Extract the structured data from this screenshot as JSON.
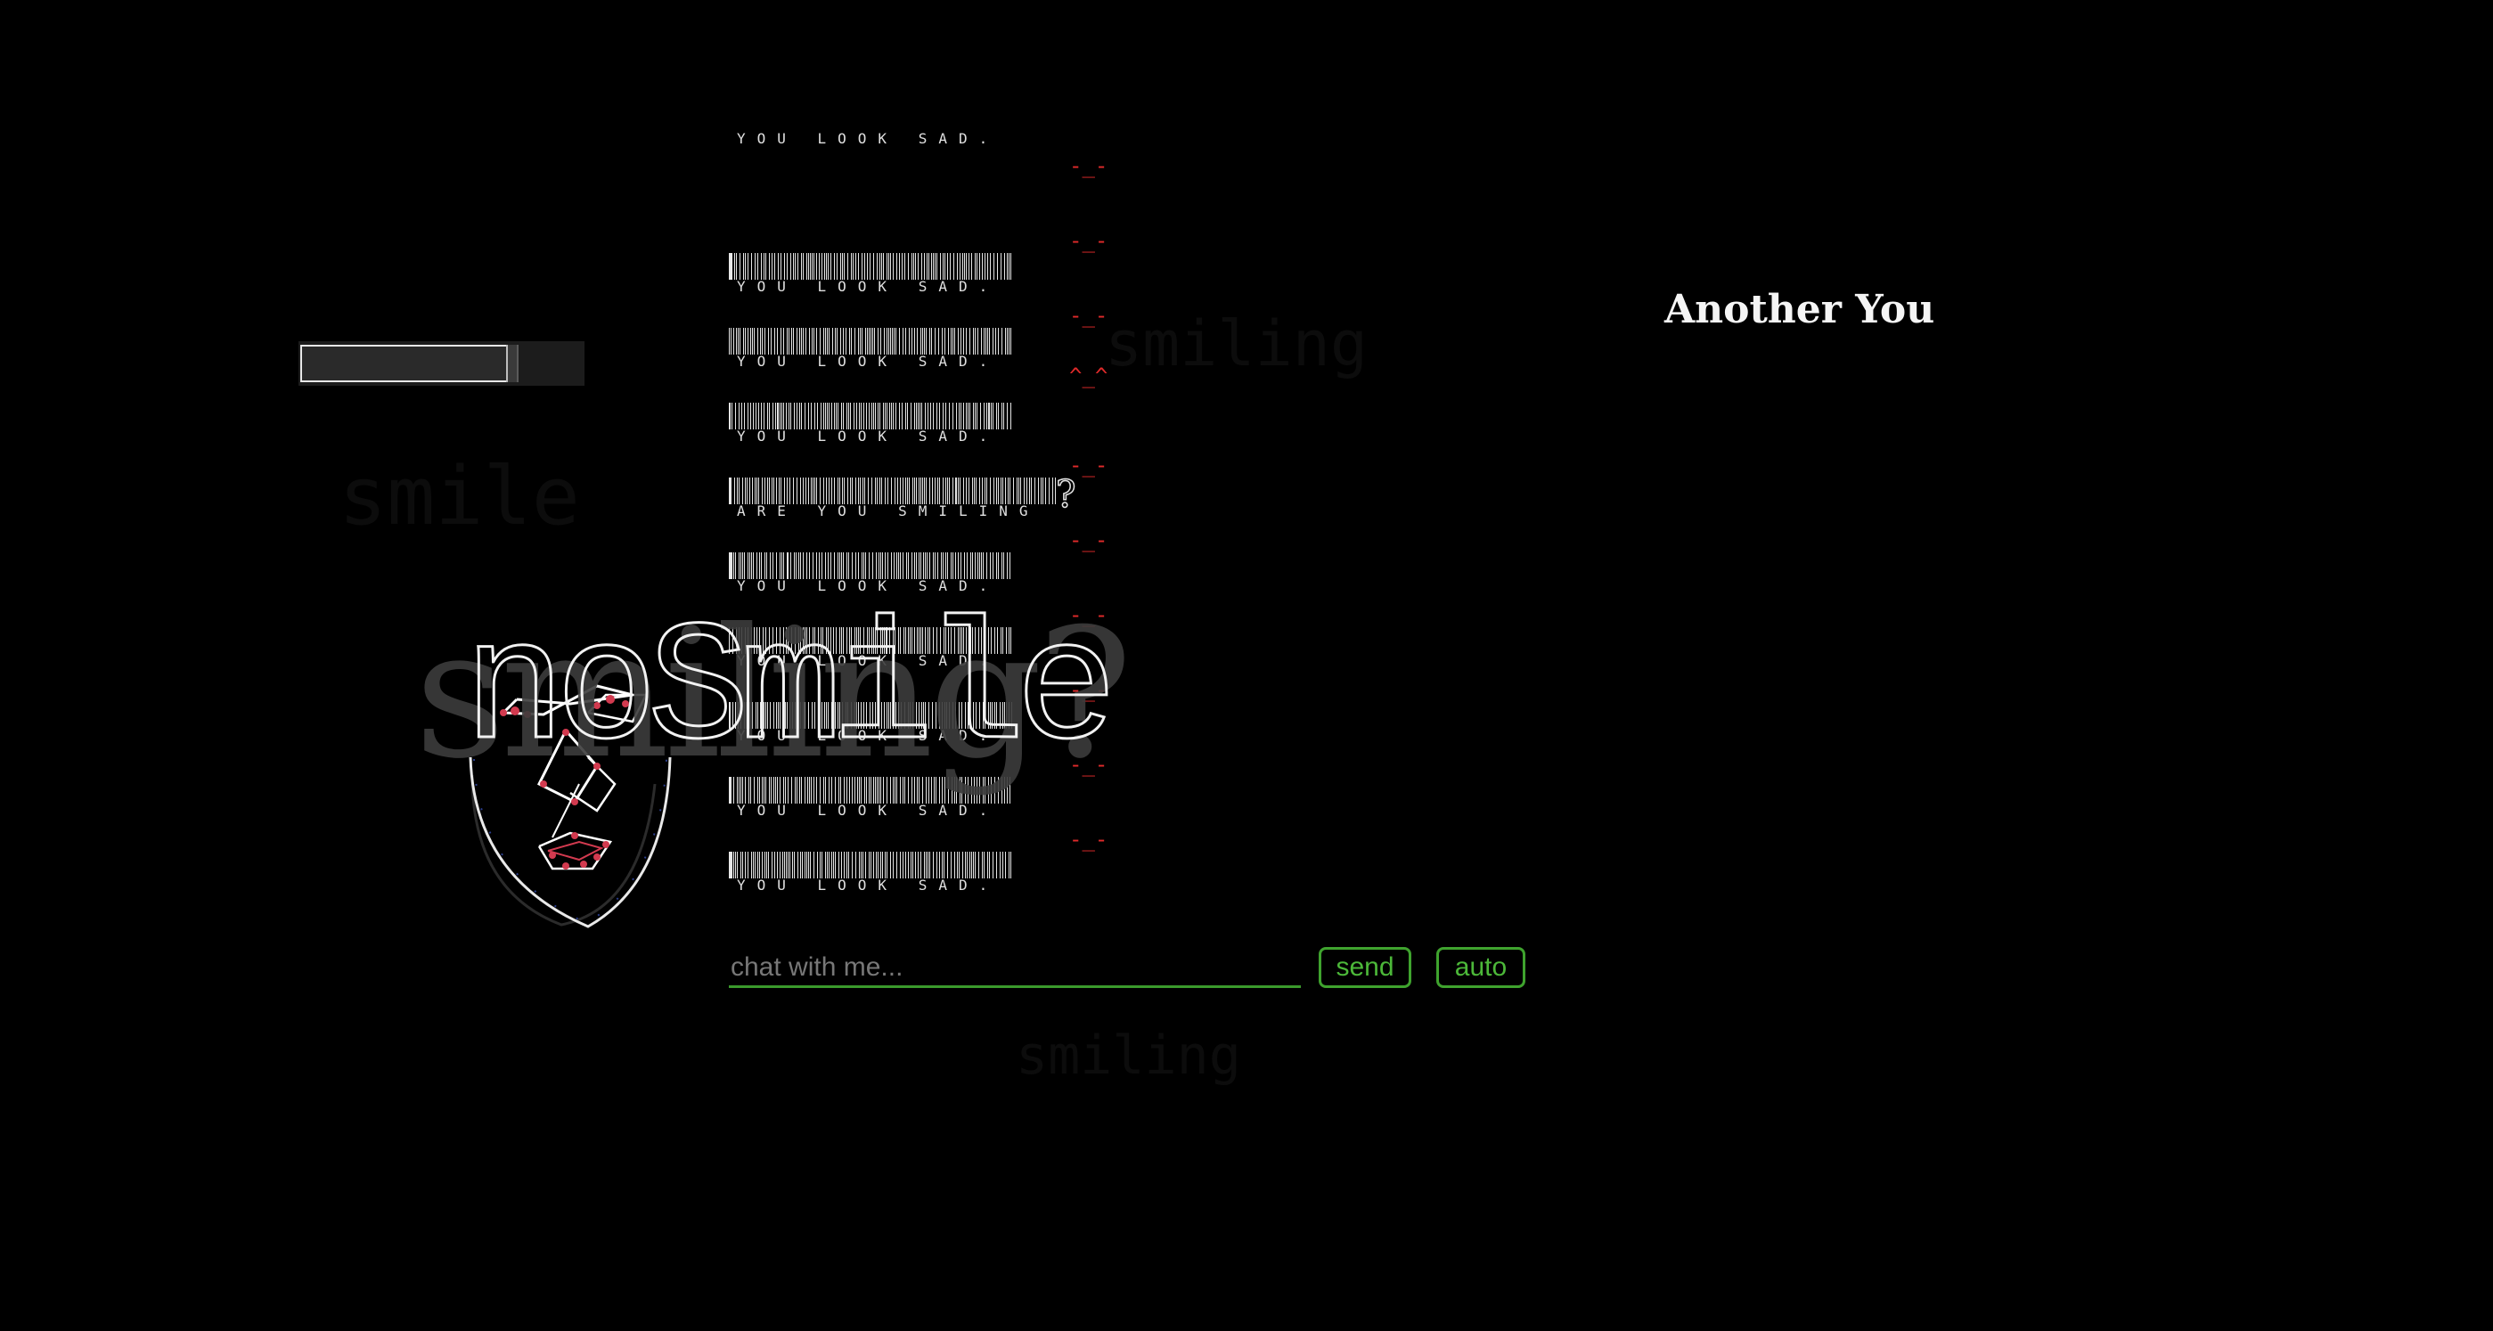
{
  "app": {
    "title": "Another You"
  },
  "background_words": [
    "smiling",
    "smile",
    "smiling"
  ],
  "overlay": {
    "ghost_text": "smiling?",
    "outline_text": "noSmile"
  },
  "meter": {
    "level": 0.72
  },
  "log": {
    "messages": [
      {
        "caption": "YOU LOOK SAD.",
        "emote": "-_-",
        "barcode": false
      },
      {
        "caption": "YOU LOOK SAD.",
        "emote": "-_-",
        "barcode": true
      },
      {
        "caption": "YOU LOOK SAD.",
        "emote": "-_-",
        "barcode": true
      },
      {
        "caption": "YOU LOOK SAD.",
        "emote": "^_^",
        "barcode": true
      },
      {
        "caption": "ARE YOU SMILING",
        "emote": "-_-",
        "barcode": true,
        "question": "?"
      },
      {
        "caption": "YOU LOOK SAD.",
        "emote": "-_-",
        "barcode": true
      },
      {
        "caption": "YOU LOOK SAD.",
        "emote": "-_-",
        "barcode": true
      },
      {
        "caption": "YOU LOOK SAD.",
        "emote": "-_-",
        "barcode": true
      },
      {
        "caption": "YOU LOOK SAD.",
        "emote": "-_-",
        "barcode": true
      },
      {
        "caption": "YOU LOOK SAD.",
        "emote": "-_-",
        "barcode": true
      },
      {
        "caption": "YOU LOOK SAD.",
        "emote": "",
        "barcode": true
      }
    ]
  },
  "chat": {
    "placeholder": "chat with me...",
    "value": "",
    "send_label": "send",
    "auto_label": "auto"
  },
  "colors": {
    "accent_green": "#3fa32e",
    "emote_red": "#e02a2a",
    "background": "#000000",
    "text": "#f5f5f5"
  },
  "icons": {
    "face": "face-mesh-icon"
  }
}
